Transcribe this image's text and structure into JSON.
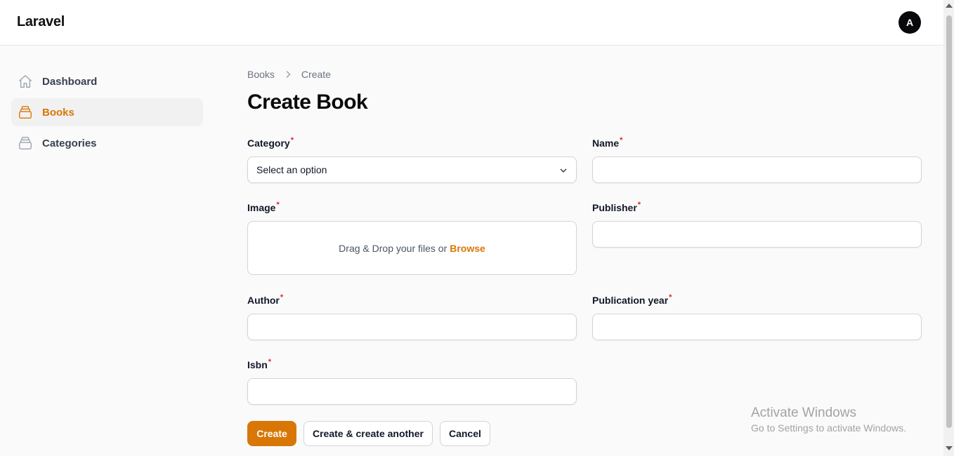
{
  "app": {
    "brand": "Laravel",
    "avatar_initial": "A"
  },
  "sidebar": {
    "items": [
      {
        "label": "Dashboard",
        "icon": "home-icon",
        "active": false
      },
      {
        "label": "Books",
        "icon": "stack-icon",
        "active": true
      },
      {
        "label": "Categories",
        "icon": "stack-icon",
        "active": false
      }
    ]
  },
  "breadcrumb": {
    "parent": "Books",
    "current": "Create"
  },
  "page": {
    "title": "Create Book"
  },
  "form": {
    "category": {
      "label": "Category",
      "value": "Select an option"
    },
    "name": {
      "label": "Name",
      "value": ""
    },
    "image": {
      "label": "Image",
      "prompt": "Drag & Drop your files or",
      "browse": "Browse"
    },
    "publisher": {
      "label": "Publisher",
      "value": ""
    },
    "author": {
      "label": "Author",
      "value": ""
    },
    "publication_year": {
      "label": "Publication year",
      "value": ""
    },
    "isbn": {
      "label": "Isbn",
      "value": ""
    },
    "required_marker": "*"
  },
  "actions": {
    "create": "Create",
    "create_another": "Create & create another",
    "cancel": "Cancel"
  },
  "watermark": {
    "title": "Activate Windows",
    "subtitle": "Go to Settings to activate Windows."
  },
  "colors": {
    "accent": "#d97706",
    "required": "#dc2626"
  }
}
